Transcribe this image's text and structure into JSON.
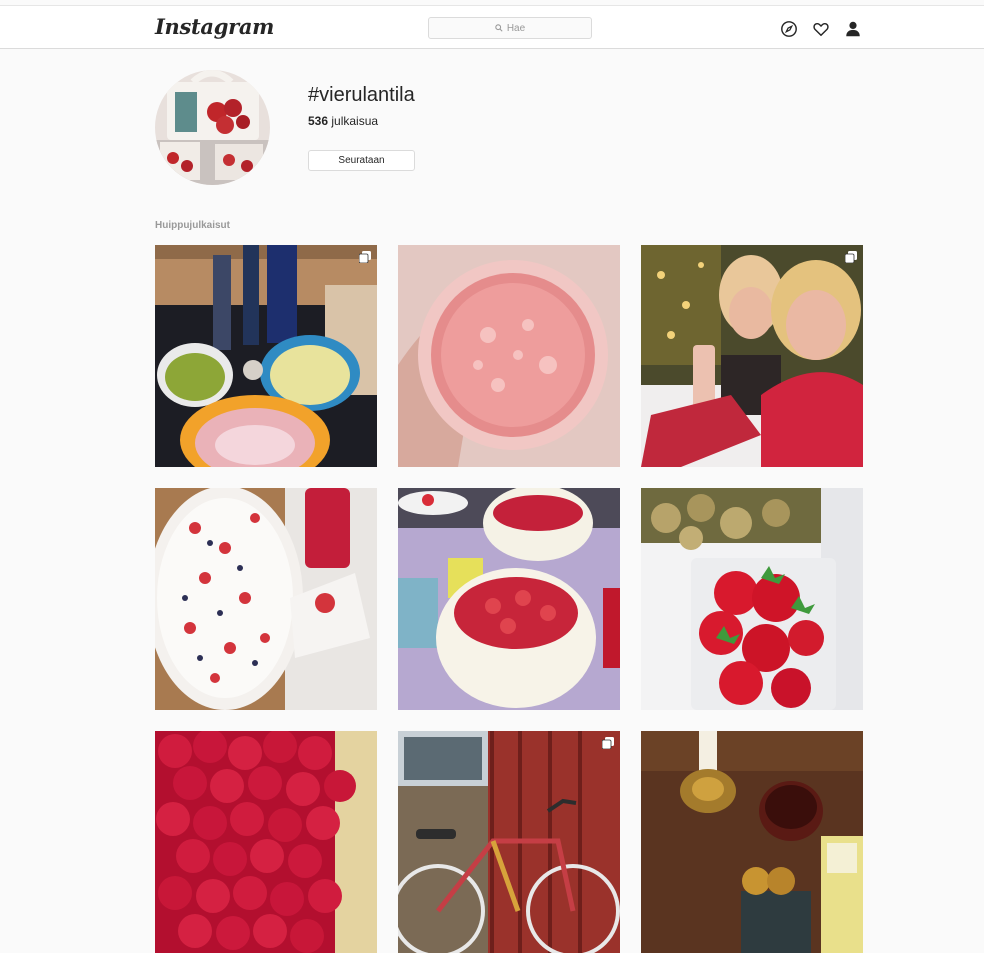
{
  "header": {
    "logo": "Instagram",
    "search_placeholder": "Hae",
    "icons": [
      "compass-icon",
      "heart-icon",
      "person-icon"
    ]
  },
  "hashtag": {
    "title": "#vierulantila",
    "post_count": "536",
    "post_count_label": "julkaisua",
    "follow_label": "Seurataan"
  },
  "section": {
    "label": "Huippujulkaisut"
  },
  "posts": [
    {
      "name": "post-vegetables-bottles",
      "multi": true
    },
    {
      "name": "post-smoothie-glass",
      "multi": false
    },
    {
      "name": "post-two-women-wine",
      "multi": true
    },
    {
      "name": "post-berry-pie",
      "multi": false
    },
    {
      "name": "post-strawberry-cakes",
      "multi": false
    },
    {
      "name": "post-strawberries-potatoes",
      "multi": false
    },
    {
      "name": "post-raspberries",
      "multi": false
    },
    {
      "name": "post-bicycle",
      "multi": true
    },
    {
      "name": "post-candle-table",
      "multi": false
    }
  ],
  "colors": {
    "background": "#fafafa",
    "border": "#dbdbdb",
    "text": "#262626",
    "muted": "#999999"
  }
}
